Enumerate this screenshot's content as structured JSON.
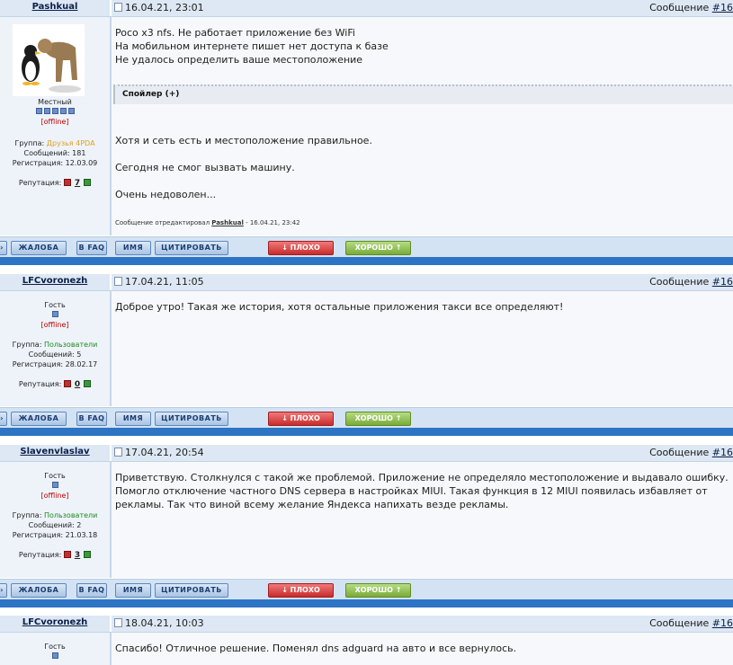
{
  "common": {
    "msg_prefix": "Сообщение ",
    "rep_label": "Репутация: ",
    "group_label": "Группа: ",
    "msgs_label": "Сообщений: ",
    "reg_label": "Регистрация: ",
    "buttons": {
      "complaint": "ЖАЛОБА",
      "faq": "В FAQ",
      "name": "ИМЯ",
      "quote": "ЦИТИРОВАТЬ",
      "bad": "↓ ПЛОХО",
      "good": "ХОРОШО ↑"
    },
    "colors": {
      "divider": "#2d74c4",
      "bad": "#c82b2b",
      "good": "#79ab39",
      "offline": "#c00000"
    }
  },
  "posts": [
    {
      "nick": "Pashkual",
      "date": "16.04.21, 23:01",
      "msgno": "#16",
      "role": "Местный",
      "stars": 5,
      "status": "[offline]",
      "group": "Друзья 4PDA",
      "messages": "181",
      "registered": "12.03.09",
      "rep": "7",
      "lines": [
        "Poco x3 nfs. Не работает приложение без WiFi",
        "На мобильном интернете пишет нет доступа к базе",
        "Не удалось определить ваше местоположение"
      ],
      "spoiler": "Спойлер (+)",
      "lines2": [
        "Хотя и сеть есть и местоположение правильное.",
        "Сегодня не смог вызвать машину.",
        "Очень недоволен..."
      ],
      "edited_prefix": "Сообщение отредактировал ",
      "edited_by": "Pashkual",
      "edited_date": " - 16.04.21, 23:42"
    },
    {
      "nick": "LFCvoronezh",
      "date": "17.04.21, 11:05",
      "msgno": "#16",
      "role": "Гость",
      "status": "[offline]",
      "group": "Пользователи",
      "messages": "5",
      "registered": "28.02.17",
      "rep": "0",
      "lines": [
        "Доброе утро! Такая же история, хотя остальные приложения такси все определяют!"
      ]
    },
    {
      "nick": "Slavenvlaslav",
      "date": "17.04.21, 20:54",
      "msgno": "#16",
      "role": "Гость",
      "status": "[offline]",
      "group": "Пользователи",
      "messages": "2",
      "registered": "21.03.18",
      "rep": "3",
      "lines": [
        "Приветствую. Столкнулся с такой же проблемой. Приложение не определяло местоположение и выдавало ошибку.",
        "Помогло отключение частного DNS сервера в настройках MIUI. Такая функция в 12 MIUI появилась избавляет от",
        "рекламы. Так что виной всему желание Яндекса напихать везде рекламы."
      ]
    },
    {
      "nick": "LFCvoronezh",
      "date": "18.04.21, 10:03",
      "msgno": "#16",
      "role": "Гость",
      "lines": [
        "Спасибо! Отличное решение. Поменял dns adguard на авто и все вернулось."
      ]
    }
  ]
}
